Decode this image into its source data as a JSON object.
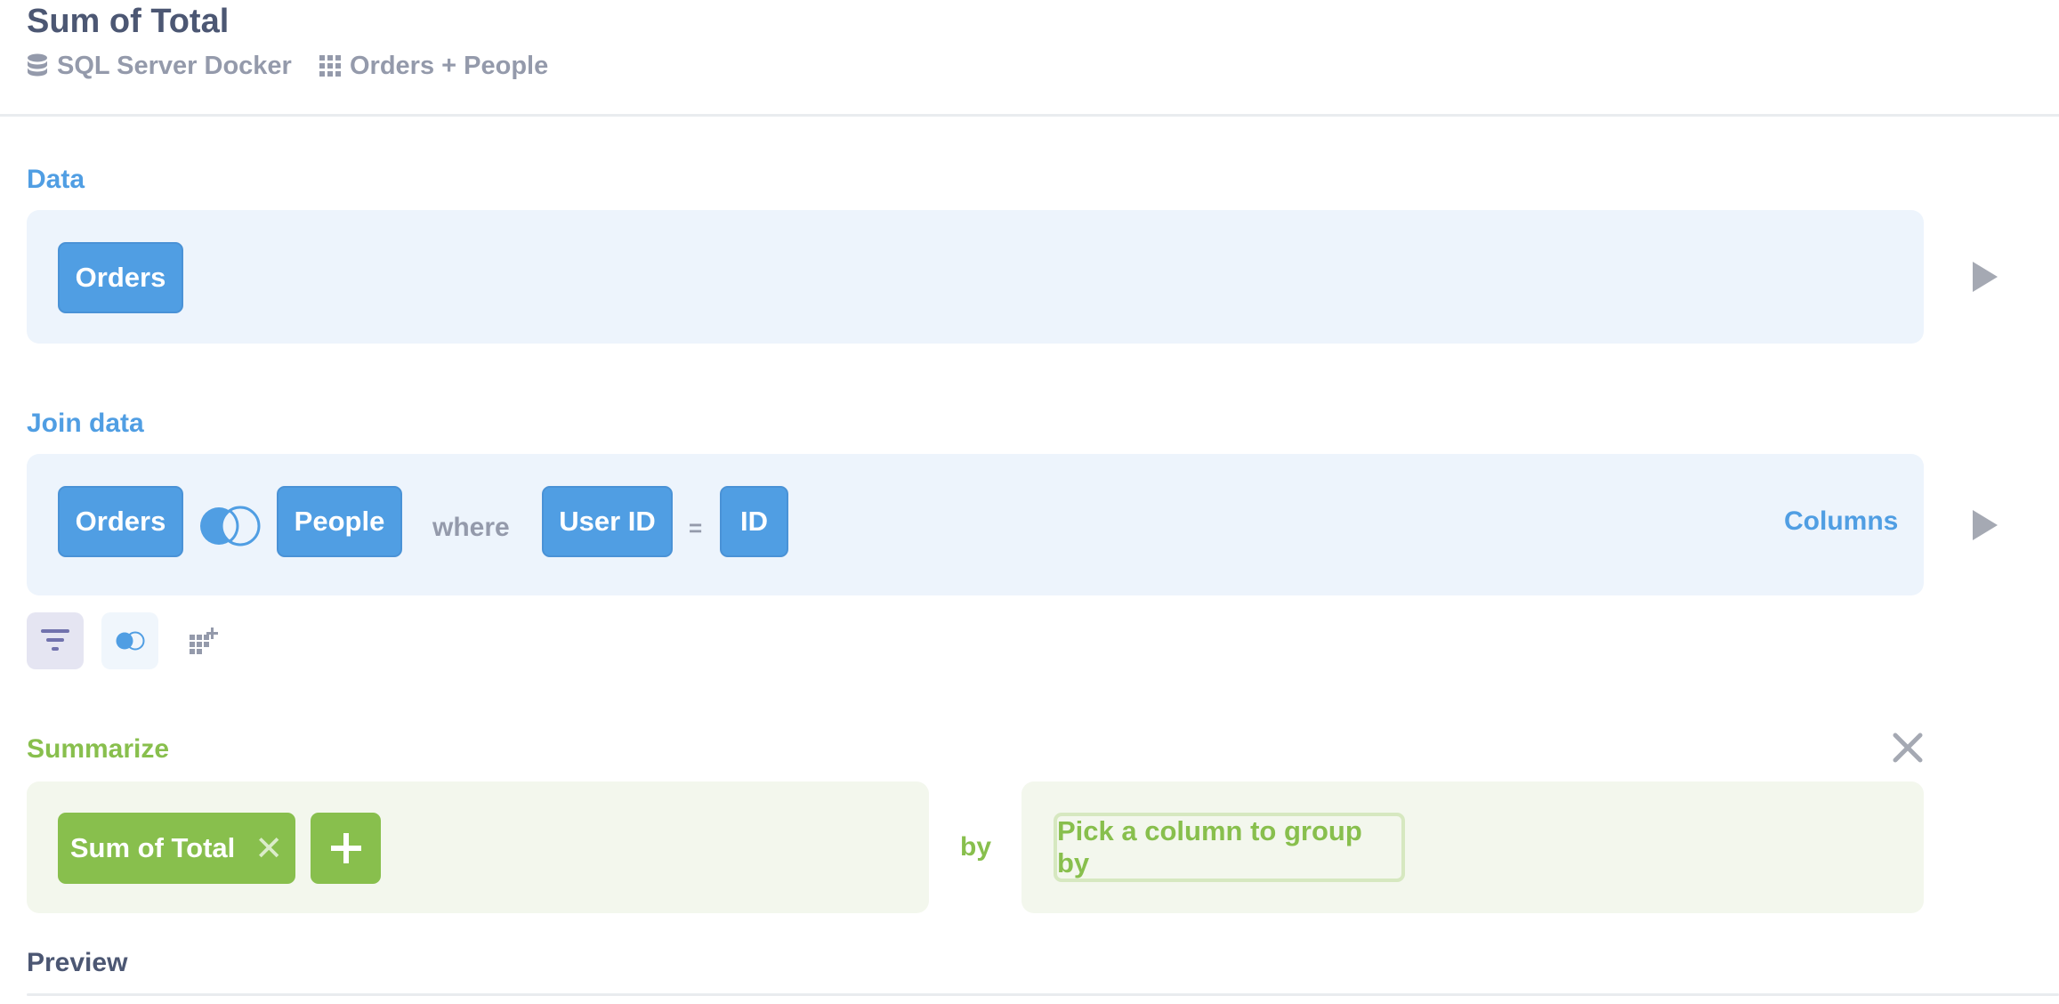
{
  "header": {
    "title": "Sum of Total",
    "database": "SQL Server Docker",
    "table": "Orders + People",
    "database_icon": "database-icon",
    "table_icon": "table-grid-icon"
  },
  "data_step": {
    "label": "Data",
    "source_table": "Orders"
  },
  "join_step": {
    "label": "Join data",
    "left_table": "Orders",
    "join_icon": "left-join-icon",
    "right_table": "People",
    "where_label": "where",
    "left_column": "User ID",
    "operator": "=",
    "right_column": "ID",
    "columns_label": "Columns"
  },
  "step_actions": [
    {
      "name": "filter",
      "icon": "filter-icon"
    },
    {
      "name": "join",
      "icon": "join-icon"
    },
    {
      "name": "custom-column",
      "icon": "add-column-icon"
    }
  ],
  "summarize_step": {
    "label": "Summarize",
    "metric": "Sum of Total",
    "add_icon": "plus-icon",
    "by_label": "by",
    "group_by_placeholder": "Pick a column to group by"
  },
  "preview": {
    "label": "Preview"
  },
  "colors": {
    "brand_blue": "#509ee3",
    "summarize_green": "#88bf4d",
    "text_dark": "#4c5773",
    "text_muted": "#949aab"
  }
}
